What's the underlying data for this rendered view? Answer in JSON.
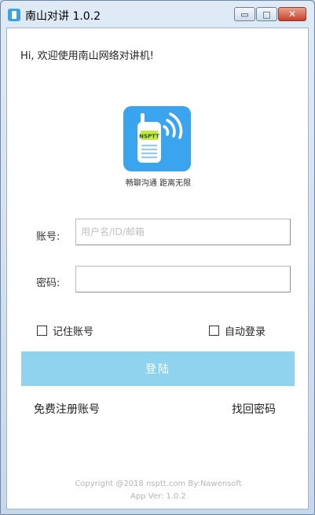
{
  "window": {
    "title": "南山对讲 1.0.2",
    "minimize_glyph": "▭",
    "maximize_glyph": "□",
    "close_glyph": "✕"
  },
  "greeting": "Hi, 欢迎使用南山网络对讲机!",
  "logo": {
    "badge": "NSPTT",
    "slogan": "畅聊沟通 距离无限",
    "icon": "walkie-talkie-icon"
  },
  "form": {
    "account_label": "账号:",
    "account_placeholder": "用户名/ID/邮箱",
    "password_label": "密码:",
    "password_value": "",
    "remember_label": "记住账号",
    "autologin_label": "自动登录",
    "login_label": "登陆"
  },
  "links": {
    "register": "免费注册账号",
    "forgot": "找回密码"
  },
  "footer": {
    "copyright": "Copyright @2018 nsptt.com By:Nawensoft",
    "version": "App Ver: 1.0.2"
  },
  "colors": {
    "accent": "#3aa4ee",
    "login_button": "#8fd3ef"
  }
}
